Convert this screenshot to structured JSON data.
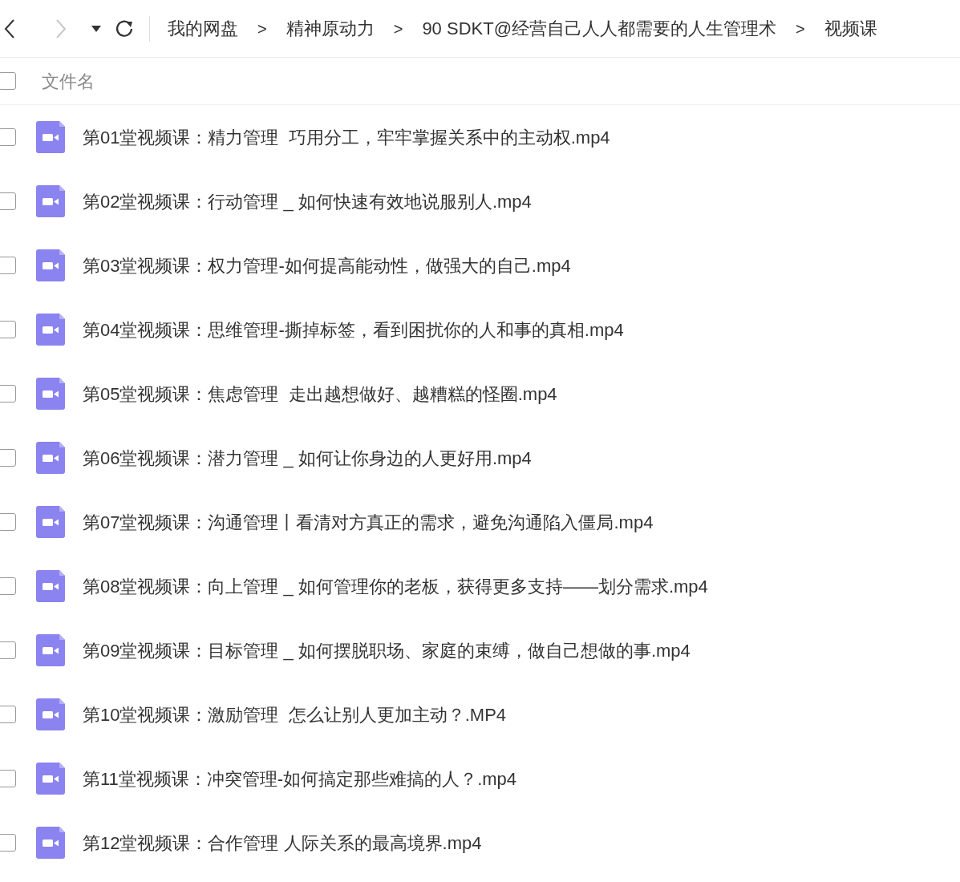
{
  "toolbar": {
    "breadcrumbs": [
      "我的网盘",
      "精神原动力",
      "90 SDKT@经营自己人人都需要的人生管理术",
      "视频课"
    ],
    "separator": ">"
  },
  "header": {
    "checked": false,
    "label": "文件名"
  },
  "files": [
    {
      "name": "第01堂视频课：精力管理  巧用分工，牢牢掌握关系中的主动权.mp4",
      "checked": false
    },
    {
      "name": "第02堂视频课：行动管理 _ 如何快速有效地说服别人.mp4",
      "checked": false
    },
    {
      "name": "第03堂视频课：权力管理-如何提高能动性，做强大的自己.mp4",
      "checked": false
    },
    {
      "name": "第04堂视频课：思维管理-撕掉标签，看到困扰你的人和事的真相.mp4",
      "checked": false
    },
    {
      "name": "第05堂视频课：焦虑管理  走出越想做好、越糟糕的怪圈.mp4",
      "checked": false
    },
    {
      "name": "第06堂视频课：潜力管理 _ 如何让你身边的人更好用.mp4",
      "checked": false
    },
    {
      "name": "第07堂视频课：沟通管理丨看清对方真正的需求，避免沟通陷入僵局.mp4",
      "checked": false
    },
    {
      "name": "第08堂视频课：向上管理 _ 如何管理你的老板，获得更多支持——划分需求.mp4",
      "checked": false
    },
    {
      "name": "第09堂视频课：目标管理 _ 如何摆脱职场、家庭的束缚，做自己想做的事.mp4",
      "checked": false
    },
    {
      "name": "第10堂视频课：激励管理  怎么让别人更加主动？.MP4",
      "checked": false
    },
    {
      "name": "第11堂视频课：冲突管理-如何搞定那些难搞的人？.mp4",
      "checked": false
    },
    {
      "name": "第12堂视频课：合作管理 人际关系的最高境界.mp4",
      "checked": false
    }
  ]
}
